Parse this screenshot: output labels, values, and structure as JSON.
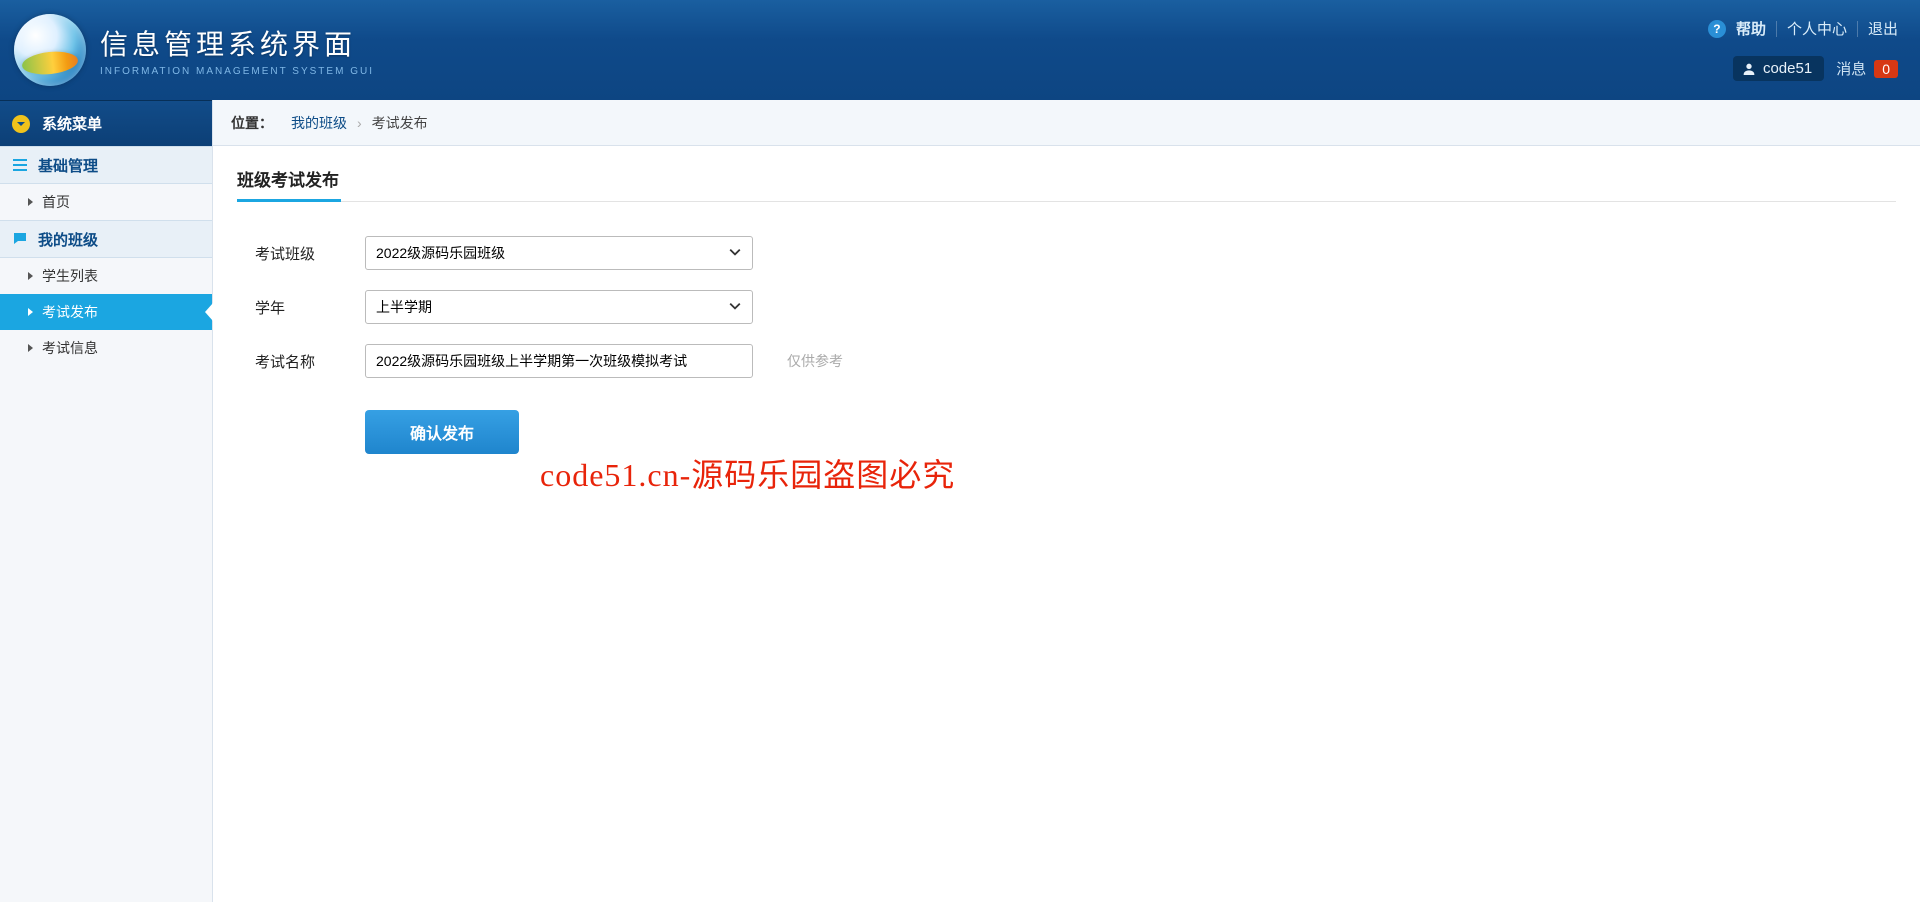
{
  "brand": {
    "title": "信息管理系统界面",
    "subtitle": "INFORMATION MANAGEMENT SYSTEM GUI"
  },
  "header": {
    "help": "帮助",
    "personal_center": "个人中心",
    "logout": "退出",
    "username": "code51",
    "messages_label": "消息",
    "messages_count": "0"
  },
  "sidebar": {
    "menu_title": "系统菜单",
    "groups": [
      {
        "label": "基础管理",
        "items": [
          {
            "label": "首页",
            "active": false
          }
        ]
      },
      {
        "label": "我的班级",
        "items": [
          {
            "label": "学生列表",
            "active": false
          },
          {
            "label": "考试发布",
            "active": true
          },
          {
            "label": "考试信息",
            "active": false
          }
        ]
      }
    ]
  },
  "breadcrumb": {
    "label": "位置：",
    "path1": "我的班级",
    "sep": "›",
    "current": "考试发布"
  },
  "page": {
    "title": "班级考试发布",
    "fields": {
      "class_label": "考试班级",
      "class_value": "2022级源码乐园班级",
      "semester_label": "学年",
      "semester_value": "上半学期",
      "name_label": "考试名称",
      "name_value": "2022级源码乐园班级上半学期第一次班级模拟考试",
      "hint": "仅供参考"
    },
    "submit": "确认发布"
  },
  "watermark": "code51.cn-源码乐园盗图必究"
}
